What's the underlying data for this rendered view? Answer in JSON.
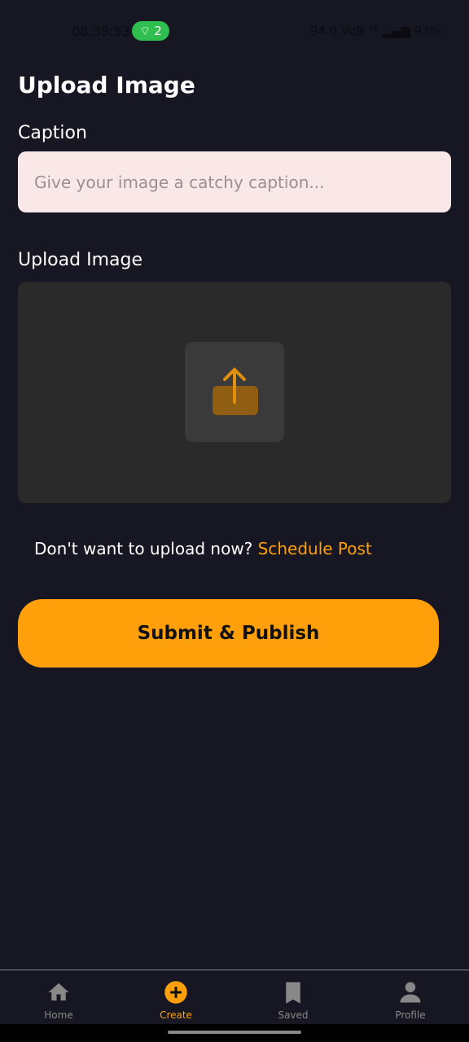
{
  "status_bar": {
    "time": "08:39:53",
    "hotspot_count": "2",
    "right": "94.0 VoB ⁴⁶ ▂▄▆ 93%"
  },
  "page": {
    "title": "Upload Image"
  },
  "caption": {
    "label": "Caption",
    "placeholder": "Give your image a catchy caption...",
    "value": ""
  },
  "upload": {
    "label": "Upload Image",
    "icon": "upload-icon"
  },
  "schedule": {
    "prompt": "Don't want to upload now?",
    "link": "Schedule Post"
  },
  "submit_label": "Submit & Publish",
  "accent": "#ff9f0a",
  "nav": {
    "items": [
      {
        "label": "Home",
        "icon": "home-icon"
      },
      {
        "label": "Create",
        "icon": "plus-circle-icon",
        "active": true
      },
      {
        "label": "Saved",
        "icon": "bookmark-icon"
      },
      {
        "label": "Profile",
        "icon": "person-icon"
      }
    ]
  }
}
